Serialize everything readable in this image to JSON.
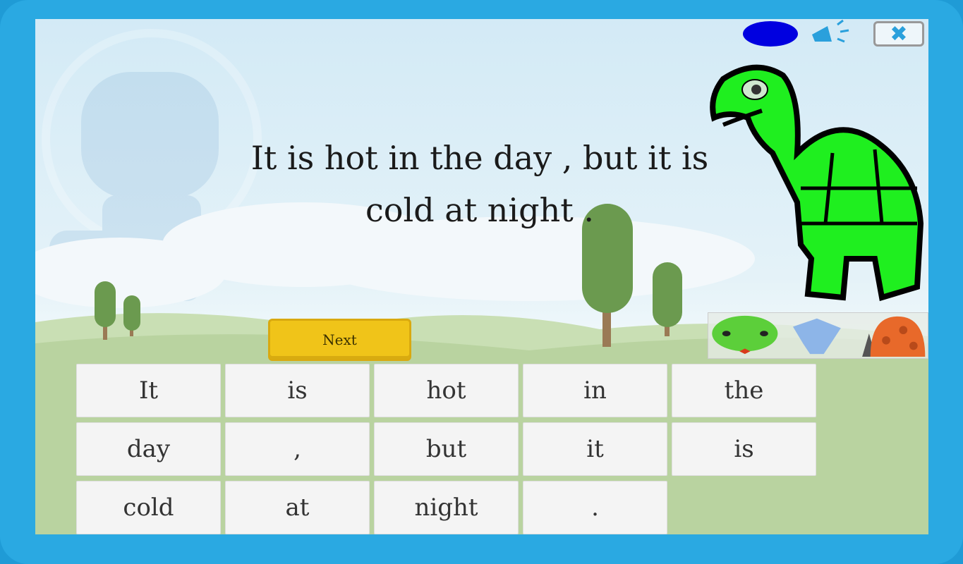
{
  "sentence": "It is hot in the day , but it is cold at night .",
  "next_label": "Next",
  "words": [
    "It",
    "is",
    "hot",
    "in",
    "the",
    "day",
    ",",
    "but",
    "it",
    "is",
    "cold",
    "at",
    "night",
    "."
  ],
  "controls": {
    "record": "record-icon",
    "sound": "speaker-icon",
    "close": "close-icon",
    "close_glyph": "✖"
  },
  "characters": [
    "snake",
    "fish",
    "ladybug"
  ],
  "colors": {
    "frame": "#2aa9e2",
    "next": "#f0c419",
    "turtle": "#1fef1f",
    "record": "#0000e0"
  }
}
